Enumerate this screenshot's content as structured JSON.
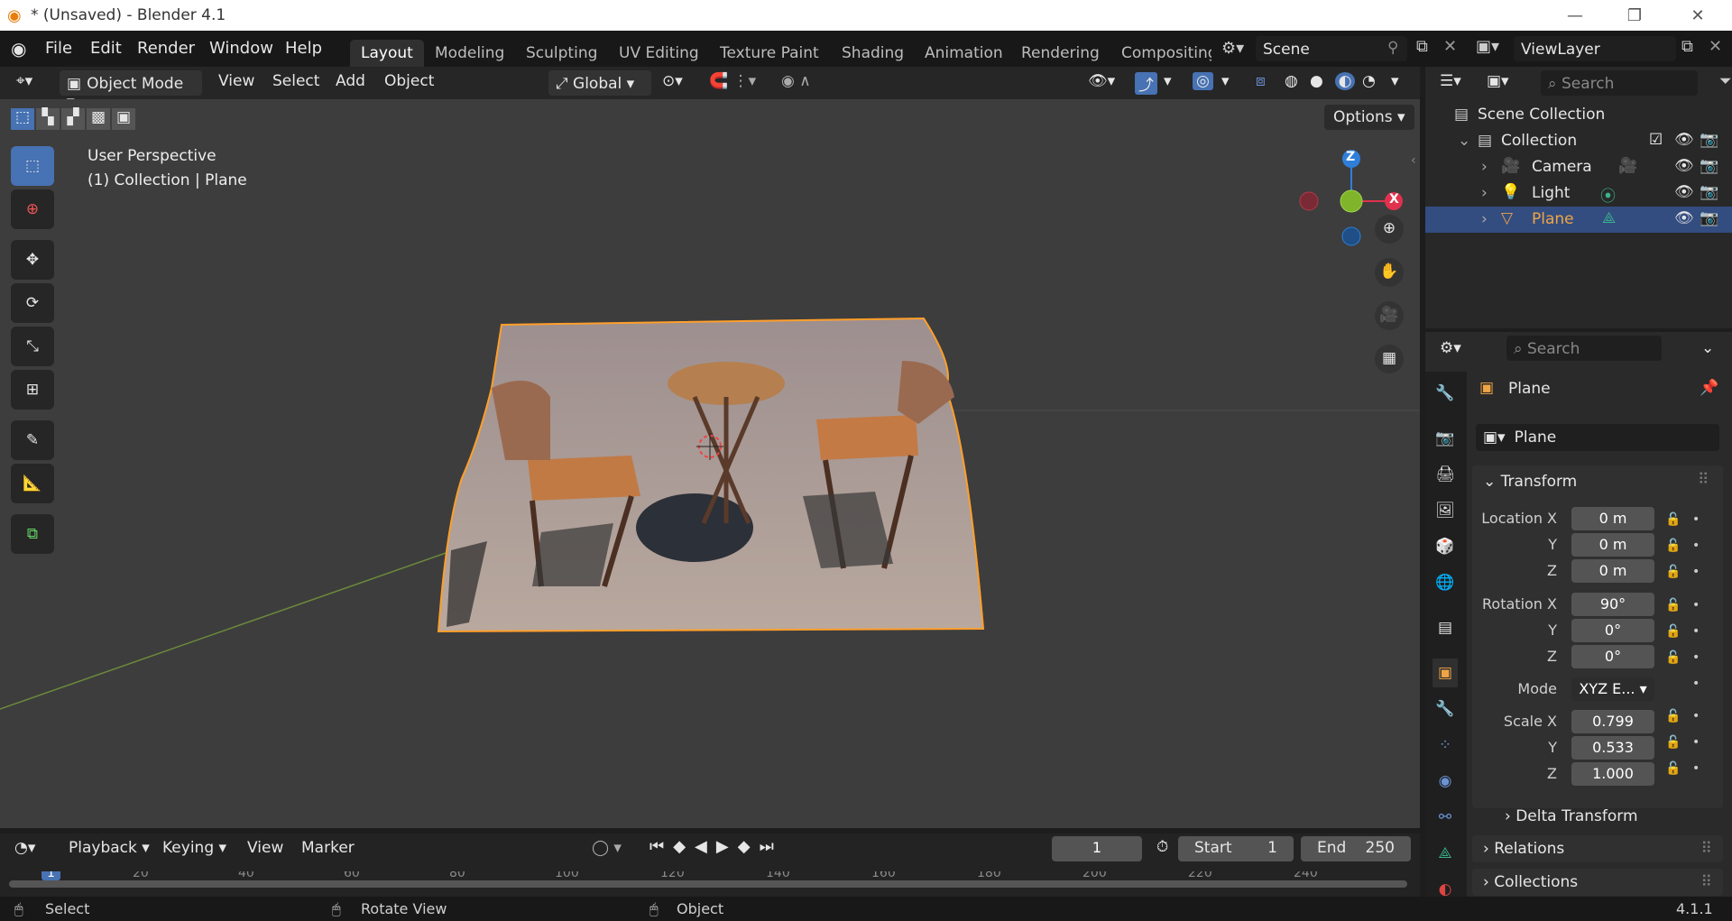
{
  "window": {
    "title": "* (Unsaved) - Blender 4.1"
  },
  "menu": [
    "File",
    "Edit",
    "Render",
    "Window",
    "Help"
  ],
  "workspaces": [
    "Layout",
    "Modeling",
    "Sculpting",
    "UV Editing",
    "Texture Paint",
    "Shading",
    "Animation",
    "Rendering",
    "Compositing"
  ],
  "scene": {
    "label": "Scene",
    "viewlayer": "ViewLayer"
  },
  "viewport_header": {
    "mode": "Object Mode",
    "menus": [
      "View",
      "Select",
      "Add",
      "Object"
    ],
    "orientation": "Global",
    "options": "Options"
  },
  "viewport": {
    "line1": "User Perspective",
    "line2": "(1) Collection | Plane",
    "gizmo_axes": [
      "Z",
      "X"
    ]
  },
  "outliner": {
    "search_placeholder": "Search",
    "scene_collection": "Scene Collection",
    "collection": "Collection",
    "items": [
      {
        "name": "Camera",
        "color": "#e8a33a"
      },
      {
        "name": "Light",
        "color": "#e8a33a"
      },
      {
        "name": "Plane",
        "color": "#f0a545",
        "selected": true
      }
    ]
  },
  "properties": {
    "search_placeholder": "Search",
    "object_name": "Plane",
    "datablock": "Plane",
    "transform": "Transform",
    "location_label": "Location X",
    "location": [
      "0 m",
      "0 m",
      "0 m"
    ],
    "rotation_label": "Rotation X",
    "rotation": [
      "90°",
      "0°",
      "0°"
    ],
    "mode_label": "Mode",
    "mode": "XYZ E...",
    "scale_label": "Scale X",
    "scale": [
      "0.799",
      "0.533",
      "1.000"
    ],
    "axes": [
      "Y",
      "Z"
    ],
    "delta": "Delta Transform",
    "relations": "Relations",
    "collections": "Collections"
  },
  "timeline": {
    "menus": [
      "Playback",
      "Keying",
      "View",
      "Marker"
    ],
    "frame": "1",
    "start_label": "Start",
    "start": "1",
    "end_label": "End",
    "end": "250",
    "ruler": [
      "1",
      "20",
      "40",
      "60",
      "80",
      "100",
      "120",
      "140",
      "160",
      "180",
      "200",
      "220",
      "240"
    ]
  },
  "status": {
    "left": "Select",
    "middle": "Rotate View",
    "right": "Object",
    "version": "4.1.1"
  },
  "colors": {
    "accent": "#4772b3",
    "selection": "#ff9f2a",
    "x_axis": "#e0314d",
    "y_axis": "#7fb42b",
    "z_axis": "#2f7fd9"
  }
}
